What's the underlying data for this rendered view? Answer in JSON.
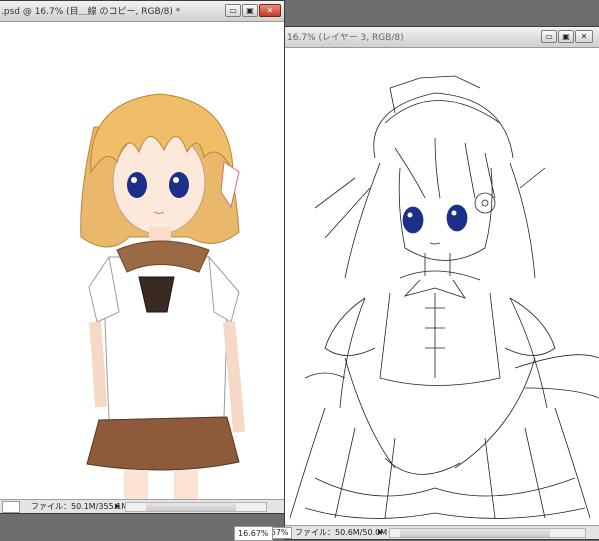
{
  "left_window": {
    "title": ".psd @ 16.7% (目＿線 のコピー, RGB/8) *",
    "controls": {
      "minimize": "▭",
      "restore": "▣",
      "close": "✕"
    },
    "status": {
      "zoom": "",
      "file_info": "ファイル：50.1M/355.1M",
      "arrow": "▶"
    }
  },
  "right_window": {
    "title": "16.7% (レイヤー 3, RGB/8)",
    "controls": {
      "minimize": "▭",
      "restore": "▣",
      "close": "✕"
    },
    "status": {
      "zoom": "16.67%",
      "file_info": "ファイル：50.6M/50.0M",
      "arrow": "▶"
    }
  },
  "colors": {
    "workspace": "#6e6e6e",
    "hair": "#e8b45c",
    "eyes": "#1c2f8a",
    "uniform_collar": "#9a6a45",
    "skirt": "#8e5a3c",
    "close_button": "#c43b26"
  }
}
